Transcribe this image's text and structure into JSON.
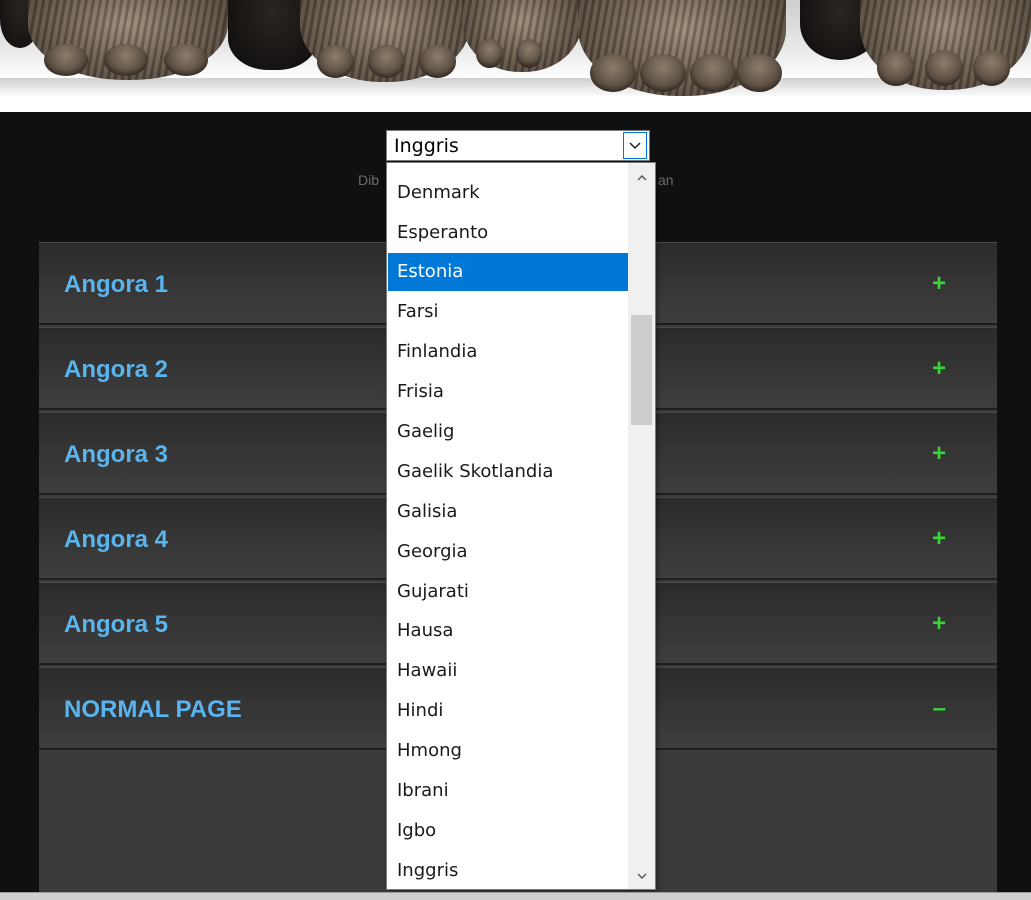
{
  "banner": {
    "alt": "cat paws photo"
  },
  "language_select": {
    "selected_value": "Inggris",
    "powered_left": "Dib",
    "powered_right": "an",
    "options": [
      "Denmark",
      "Esperanto",
      "Estonia",
      "Farsi",
      "Finlandia",
      "Frisia",
      "Gaelig",
      "Gaelik Skotlandia",
      "Galisia",
      "Georgia",
      "Gujarati",
      "Hausa",
      "Hawaii",
      "Hindi",
      "Hmong",
      "Ibrani",
      "Igbo",
      "Inggris"
    ],
    "highlighted_option": "Estonia"
  },
  "accordion": {
    "items": [
      {
        "title": "Angora 1",
        "toggle": "+"
      },
      {
        "title": "Angora 2",
        "toggle": "+"
      },
      {
        "title": "Angora 3",
        "toggle": "+"
      },
      {
        "title": "Angora 4",
        "toggle": "+"
      },
      {
        "title": "Angora 5",
        "toggle": "+"
      },
      {
        "title": "NORMAL PAGE",
        "toggle": "–"
      }
    ]
  },
  "colors": {
    "accordion_title": "#5ab4ee",
    "toggle": "#3ad43a",
    "selection": "#0078d7",
    "background": "#0f1012"
  }
}
